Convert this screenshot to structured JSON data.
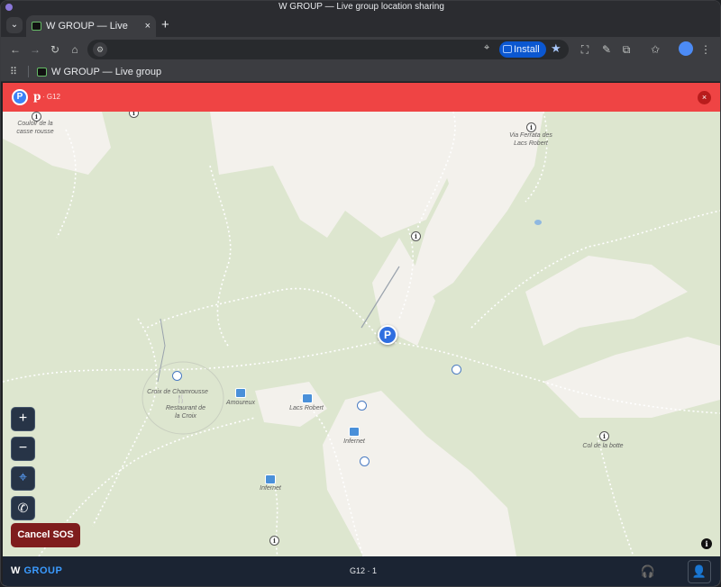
{
  "window": {
    "title": "W GROUP — Live group location sharing"
  },
  "tabs": [
    {
      "label": "W GROUP — Live group",
      "close": "×"
    }
  ],
  "tabstrip": {
    "search_glyph": "⌄",
    "new_tab_glyph": "+"
  },
  "toolbar": {
    "back": "←",
    "forward": "→",
    "reload": "↻",
    "home": "⌂",
    "site_settings": "⚙",
    "location_glyph": "⌖",
    "install_label": "Install",
    "star_glyph": "★",
    "extra_icons": [
      "⛶",
      "✎",
      "⧉",
      "✩",
      "⋮"
    ]
  },
  "bookmarks": {
    "apps_glyph": "⠿",
    "items": [
      {
        "label": "W GROUP — Live group"
      }
    ]
  },
  "alert": {
    "badge": "P",
    "name": "p",
    "group": "· G12",
    "close": "×",
    "color": "#ef4444"
  },
  "map": {
    "labels": [
      {
        "text": "Couloir de la casse rousse"
      },
      {
        "text": "Via Ferrata des Lacs Robert"
      },
      {
        "text": "Croix de Chamrousse"
      },
      {
        "text": "Restaurant de la Croix"
      },
      {
        "text": "Amoureux"
      },
      {
        "text": "Lacs Robert"
      },
      {
        "text": "Infernet"
      },
      {
        "text": "Infernet"
      },
      {
        "text": "Col de la botte"
      }
    ],
    "member_marker": "P",
    "info_glyph": "i",
    "attribution_glyph": "i",
    "colors": {
      "meadow": "#dde6cf",
      "rock": "#f3f1ec",
      "path": "#ffffff",
      "marker": "#2f6ee0"
    }
  },
  "controls": {
    "zoom_in": "+",
    "zoom_out": "−",
    "locate": "⌖",
    "call": "✆",
    "sos": "Cancel SOS"
  },
  "bottombar": {
    "brand_w": "W",
    "brand_group": "GROUP",
    "group_info": "G12 · 1",
    "support_glyph": "🎧",
    "profile_glyph": "👤"
  }
}
